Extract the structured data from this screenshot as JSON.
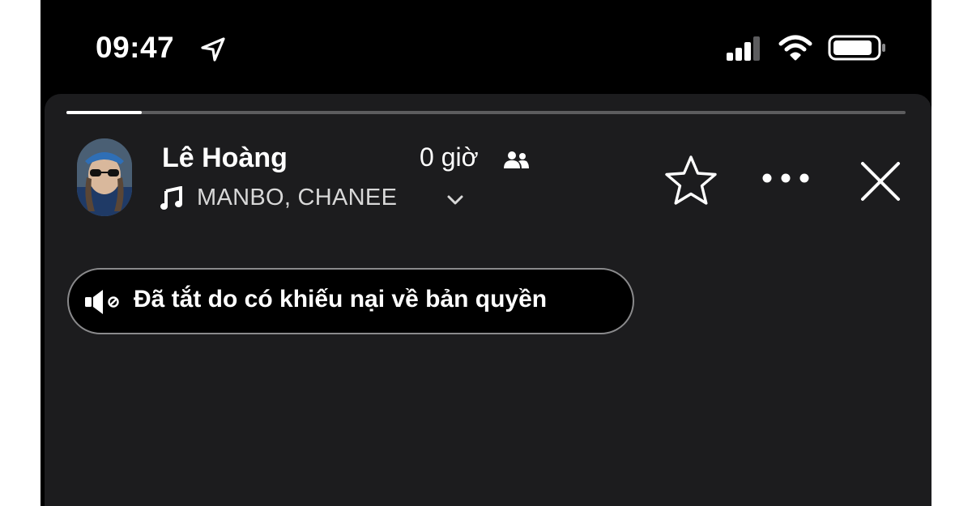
{
  "status_bar": {
    "time": "09:47",
    "icons": [
      "location-arrow-icon",
      "cellular-signal-icon",
      "wifi-icon",
      "battery-icon"
    ]
  },
  "story": {
    "progress": 0.09,
    "user_name": "Lê Hoàng",
    "elapsed": "0 giờ",
    "audience_icon": "friends-icon",
    "music_icon": "music-note-icon",
    "music_label": "MANBO, CHANEE",
    "actions": [
      "star-icon",
      "more-icon",
      "close-icon"
    ],
    "muted_notice": "Đã tắt do có khiếu nại về bản quyền"
  },
  "colors": {
    "background": "#000000",
    "panel": "#1c1c1e",
    "text": "#ffffff",
    "secondary_text": "#d8d8d8",
    "progress_track": "#5c5c5e",
    "pill_border": "#8a8a8c"
  }
}
